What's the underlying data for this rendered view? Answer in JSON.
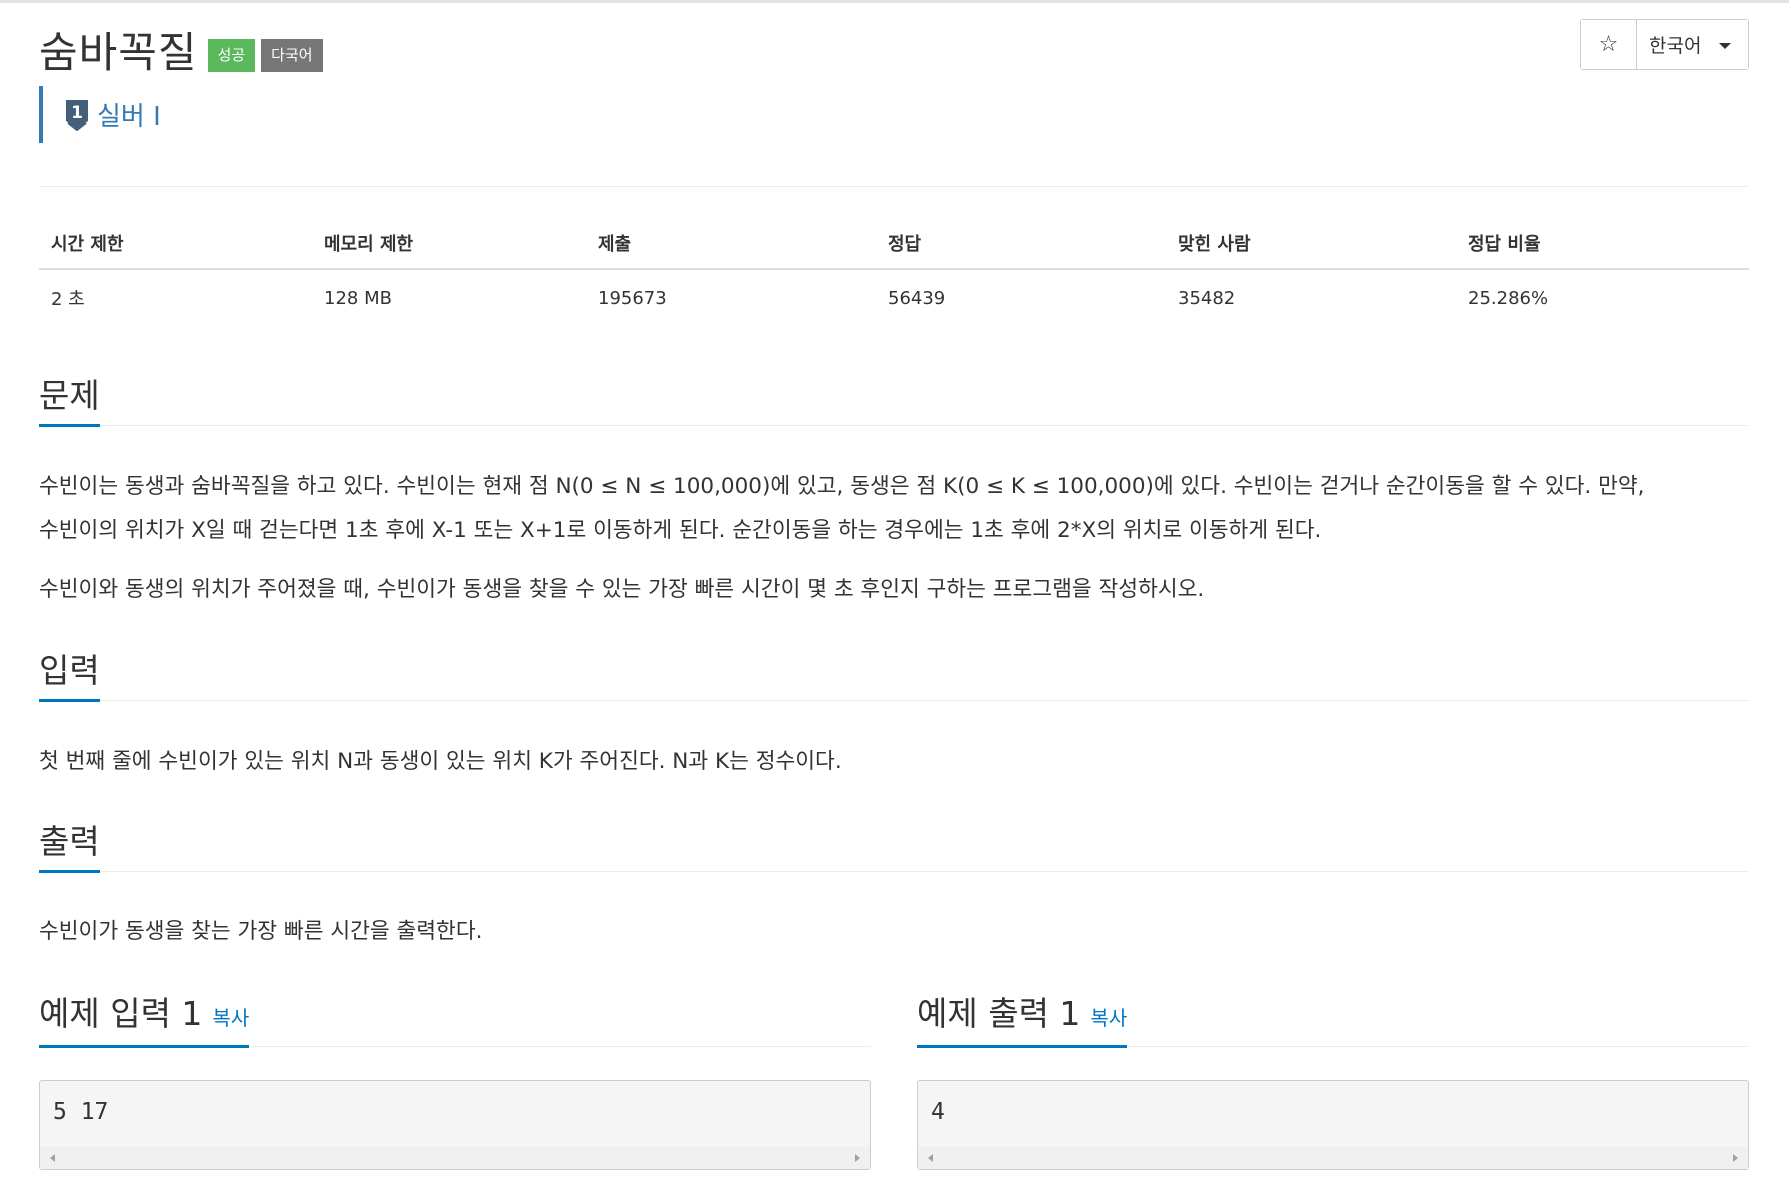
{
  "problem": {
    "title": "숨바꼭질",
    "labels": [
      "성공",
      "다국어"
    ],
    "tier": "실버 I",
    "tier_badge_number": "1"
  },
  "toolbar": {
    "star": "☆",
    "language": "한국어"
  },
  "stats": {
    "headers": [
      "시간 제한",
      "메모리 제한",
      "제출",
      "정답",
      "맞힌 사람",
      "정답 비율"
    ],
    "values": [
      "2 초",
      "128 MB",
      "195673",
      "56439",
      "35482",
      "25.286%"
    ]
  },
  "sections": {
    "problem_title": "문제",
    "problem_lines": [
      "수빈이는 동생과 숨바꼭질을 하고 있다. 수빈이는 현재 점 N(0 ≤ N ≤ 100,000)에 있고, 동생은 점 K(0 ≤ K ≤ 100,000)에 있다. 수빈이는 걷거나 순간이동을 할 수 있다. 만약,",
      "수빈이의 위치가 X일 때 걷는다면 1초 후에 X-1 또는 X+1로 이동하게 된다. 순간이동을 하는 경우에는 1초 후에 2*X의 위치로 이동하게 된다.",
      "수빈이와 동생의 위치가 주어졌을 때, 수빈이가 동생을 찾을 수 있는 가장 빠른 시간이 몇 초 후인지 구하는 프로그램을 작성하시오."
    ],
    "input_title": "입력",
    "input_text": "첫 번째 줄에 수빈이가 있는 위치 N과 동생이 있는 위치 K가 주어진다. N과 K는 정수이다.",
    "output_title": "출력",
    "output_text": "수빈이가 동생을 찾는 가장 빠른 시간을 출력한다."
  },
  "samples": [
    {
      "title": "예제 입력 1",
      "copy": "복사",
      "content": "5 17"
    },
    {
      "title": "예제 출력 1",
      "copy": "복사",
      "content": "4"
    }
  ],
  "colors": {
    "accent": "#0076c0",
    "tier_blue": "#337ab7",
    "success": "#5cb85c",
    "default_label": "#777777"
  }
}
